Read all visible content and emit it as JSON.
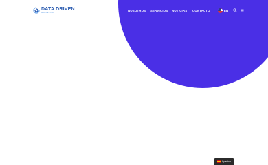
{
  "brand": {
    "name": "DATA DRIVEN",
    "tagline": "MARKETING",
    "logo_color": "#2a5bb0",
    "icon": "data-driven-logo-mark"
  },
  "header": {
    "nav": [
      {
        "label": "NOSOTROS"
      },
      {
        "label": "SERVICIOS"
      },
      {
        "label": "NOTICIAS"
      },
      {
        "label": "CONTACTO"
      }
    ],
    "language": {
      "label": "EN",
      "icon": "us-flag-icon"
    },
    "search_icon": "search-icon",
    "menu_icon": "hamburger-menu-icon"
  },
  "hero": {
    "accent_color": "#4a2fe6"
  },
  "language_switcher": {
    "label": "Spanish",
    "icon": "spain-flag-icon"
  }
}
